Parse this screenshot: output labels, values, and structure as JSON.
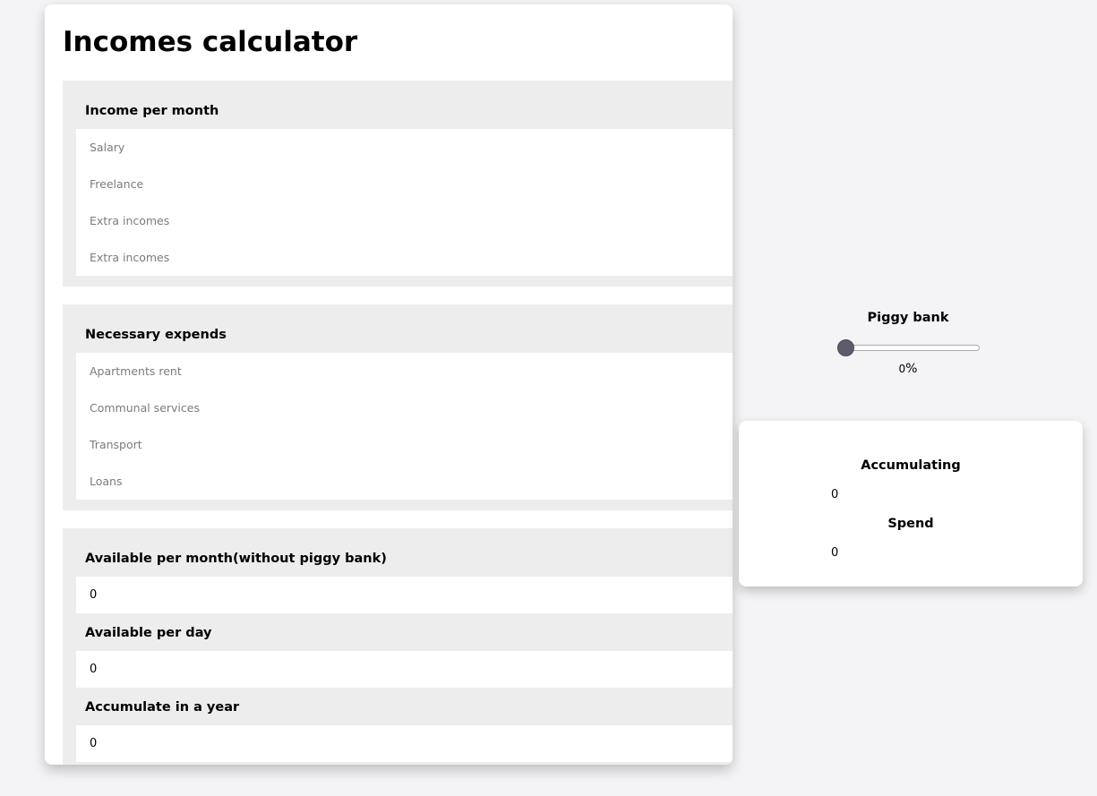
{
  "page": {
    "title": "Incomes calculator"
  },
  "income": {
    "heading": "Income per month",
    "fields": [
      {
        "placeholder": "Salary",
        "value": ""
      },
      {
        "placeholder": "Freelance",
        "value": ""
      },
      {
        "placeholder": "Extra incomes",
        "value": ""
      },
      {
        "placeholder": "Extra incomes",
        "value": ""
      }
    ]
  },
  "expends": {
    "heading": "Necessary expends",
    "fields": [
      {
        "placeholder": "Apartments rent",
        "value": ""
      },
      {
        "placeholder": "Communal services",
        "value": ""
      },
      {
        "placeholder": "Transport",
        "value": ""
      },
      {
        "placeholder": "Loans",
        "value": ""
      }
    ]
  },
  "summary": {
    "available_month_label": "Available per month(without piggy bank)",
    "available_month_value": "0",
    "available_day_label": "Available per day",
    "available_day_value": "0",
    "accumulate_year_label": "Accumulate in a year",
    "accumulate_year_value": "0"
  },
  "piggy_bank": {
    "title": "Piggy bank",
    "percent_value": "0",
    "percent_sign": "%",
    "slider_level": 0
  },
  "results": {
    "accumulating_label": "Accumulating",
    "accumulating_value": "0",
    "spend_label": "Spend",
    "spend_value": "0"
  },
  "colors": {
    "page_background": "#f4f4f6",
    "section_background": "#ededee",
    "slider_thumb": "#5c5c6c"
  }
}
